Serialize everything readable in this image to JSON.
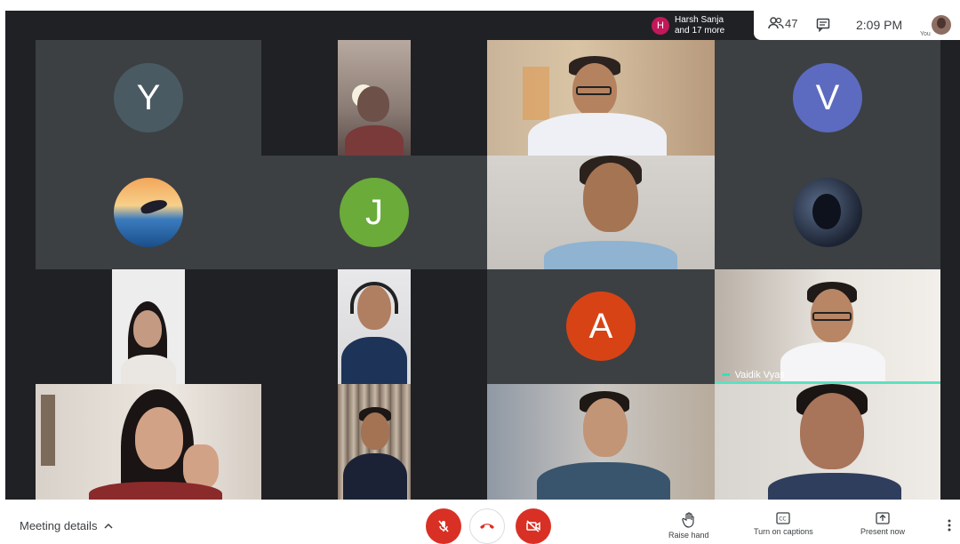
{
  "top_bar": {
    "toast_initial": "H",
    "toast_line1": "Harsh Sanja",
    "toast_line2": "and 17 more",
    "people_count": "47",
    "clock": "2:09 PM",
    "self_label": "You"
  },
  "tiles": {
    "y_initial": "Y",
    "v_initial": "V",
    "j_initial": "J",
    "a_initial": "A",
    "vaidik_name": "Vaidik Vyas"
  },
  "bottom_bar": {
    "meeting_details": "Meeting details",
    "raise_hand": "Raise hand",
    "captions": "Turn on captions",
    "present": "Present now"
  },
  "colors": {
    "grid_bg": "#202124",
    "tile_bg": "#3c4043",
    "avatar_y": "#4a5a63",
    "avatar_v": "#5c6bc0",
    "avatar_j": "#6aab3a",
    "avatar_a": "#d84315",
    "danger": "#d93025",
    "speaking": "#5ce1c2"
  }
}
